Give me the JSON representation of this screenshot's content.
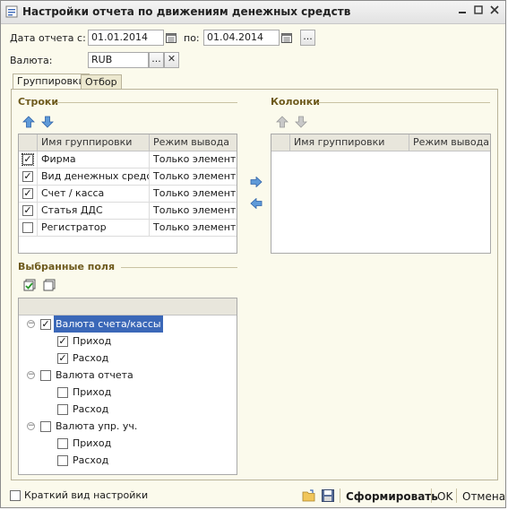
{
  "window": {
    "title": "Настройки отчета по движениям денежных средств"
  },
  "header": {
    "date_from_label": "Дата отчета с:",
    "date_from_value": "01.01.2014",
    "date_to_label": "по:",
    "date_to_value": "01.04.2014",
    "period_button": "...",
    "currency_label": "Валюта:",
    "currency_value": "RUB",
    "currency_select": "...",
    "currency_clear": "✕"
  },
  "tabs": [
    {
      "label": "Группировки",
      "active": true
    },
    {
      "label": "Отбор",
      "active": false
    }
  ],
  "rows_section": {
    "title": "Строки",
    "columns": [
      "Имя группировки",
      "Режим вывода"
    ],
    "items": [
      {
        "name": "Фирма",
        "mode": "Только элементы",
        "checked": true
      },
      {
        "name": "Вид денежных средс...",
        "mode": "Только элементы",
        "checked": true
      },
      {
        "name": "Счет / касса",
        "mode": "Только элементы",
        "checked": true
      },
      {
        "name": "Статья ДДС",
        "mode": "Только элементы",
        "checked": true
      },
      {
        "name": "Регистратор",
        "mode": "Только элементы",
        "checked": false
      }
    ]
  },
  "columns_section": {
    "title": "Колонки",
    "columns": [
      "Имя группировки",
      "Режим вывода"
    ]
  },
  "fields_section": {
    "title": "Выбранные поля",
    "groups": [
      {
        "label": "Валюта счета/кассы",
        "checked": true,
        "selected": true,
        "children": [
          {
            "label": "Приход",
            "checked": true
          },
          {
            "label": "Расход",
            "checked": true
          }
        ]
      },
      {
        "label": "Валюта отчета",
        "checked": false,
        "selected": false,
        "children": [
          {
            "label": "Приход",
            "checked": false
          },
          {
            "label": "Расход",
            "checked": false
          }
        ]
      },
      {
        "label": "Валюта упр. уч.",
        "checked": false,
        "selected": false,
        "children": [
          {
            "label": "Приход",
            "checked": false
          },
          {
            "label": "Расход",
            "checked": false
          }
        ]
      }
    ]
  },
  "footer": {
    "short_view_label": "Краткий вид настройки",
    "short_view_checked": false,
    "generate_label": "Сформировать",
    "ok_label": "OK",
    "cancel_label": "Отмена"
  },
  "colors": {
    "accent": "#3b68b8",
    "section_title": "#6e5a1d",
    "background": "#fbfaec"
  }
}
